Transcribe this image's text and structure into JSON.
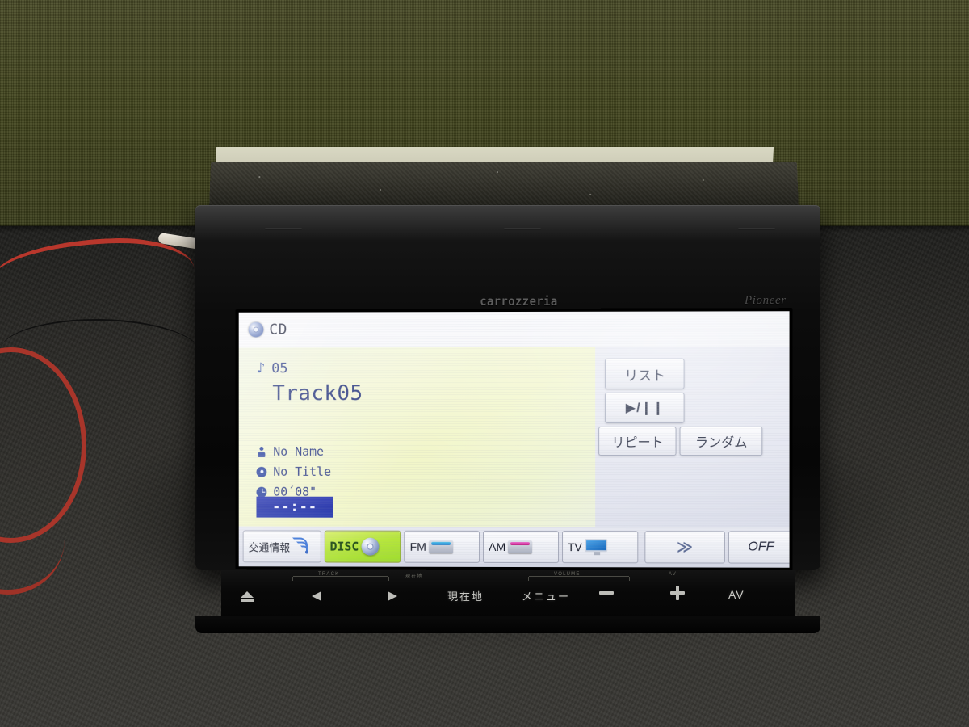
{
  "scene": {
    "device_brand_left": "carrozzeria",
    "device_brand_right": "Pioneer"
  },
  "screen": {
    "source_badge": {
      "icon": "cd-disc-icon",
      "label": "CD"
    },
    "now_playing": {
      "note_icon": "music-note-icon",
      "track_number": "05",
      "track_title": "Track05",
      "artist_icon": "person-icon",
      "artist": "No Name",
      "album_icon": "disc-icon",
      "album": "No Title",
      "time_icon": "clock-icon",
      "elapsed": "00´08\"",
      "clock": "--:--"
    },
    "controls": [
      {
        "name": "list-button",
        "label": "リスト"
      },
      {
        "name": "play-pause-button",
        "label": "▶/❙❙"
      },
      {
        "name": "repeat-button",
        "label": "リピート"
      },
      {
        "name": "random-button",
        "label": "ランダム"
      }
    ],
    "source_bar": [
      {
        "name": "traffic-info",
        "label": "交通情報",
        "icon": "broadcast-wave-icon",
        "active": false
      },
      {
        "name": "disc",
        "label": "DISC",
        "icon": "cd-disc-icon",
        "active": true
      },
      {
        "name": "fm",
        "label": "FM",
        "icon": "radio-tuner-icon",
        "active": false
      },
      {
        "name": "am",
        "label": "AM",
        "icon": "radio-tuner-icon",
        "active": false
      },
      {
        "name": "tv",
        "label": "TV",
        "icon": "television-icon",
        "active": false
      },
      {
        "name": "next-page",
        "label": "≫",
        "icon": "chevron-double-right-icon",
        "active": false
      },
      {
        "name": "off",
        "label": "OFF",
        "icon": "power-off-icon",
        "active": false
      }
    ]
  },
  "hardware": {
    "captions": [
      {
        "label": "TRACK"
      },
      {
        "label": "現在地"
      },
      {
        "label": "VOLUME"
      },
      {
        "label": "AV"
      }
    ],
    "buttons": [
      {
        "name": "eject-button",
        "label": "",
        "icon": "eject-icon"
      },
      {
        "name": "track-previous-button",
        "label": "",
        "icon": "previous-track-icon"
      },
      {
        "name": "track-next-button",
        "label": "",
        "icon": "next-track-icon"
      },
      {
        "name": "current-location-button",
        "label": "現在地",
        "icon": "location-icon"
      },
      {
        "name": "menu-button",
        "label": "メニュー",
        "icon": "menu-icon"
      },
      {
        "name": "volume-down-button",
        "label": "",
        "icon": "minus-icon"
      },
      {
        "name": "volume-up-button",
        "label": "",
        "icon": "plus-icon"
      },
      {
        "name": "av-button",
        "label": "AV",
        "icon": "av-icon"
      }
    ]
  },
  "colors": {
    "accent_green": "#b6e63c",
    "screen_text_blue": "#29397f",
    "clock_box_blue": "#2235ad",
    "backdrop_olive": "#44471f"
  }
}
